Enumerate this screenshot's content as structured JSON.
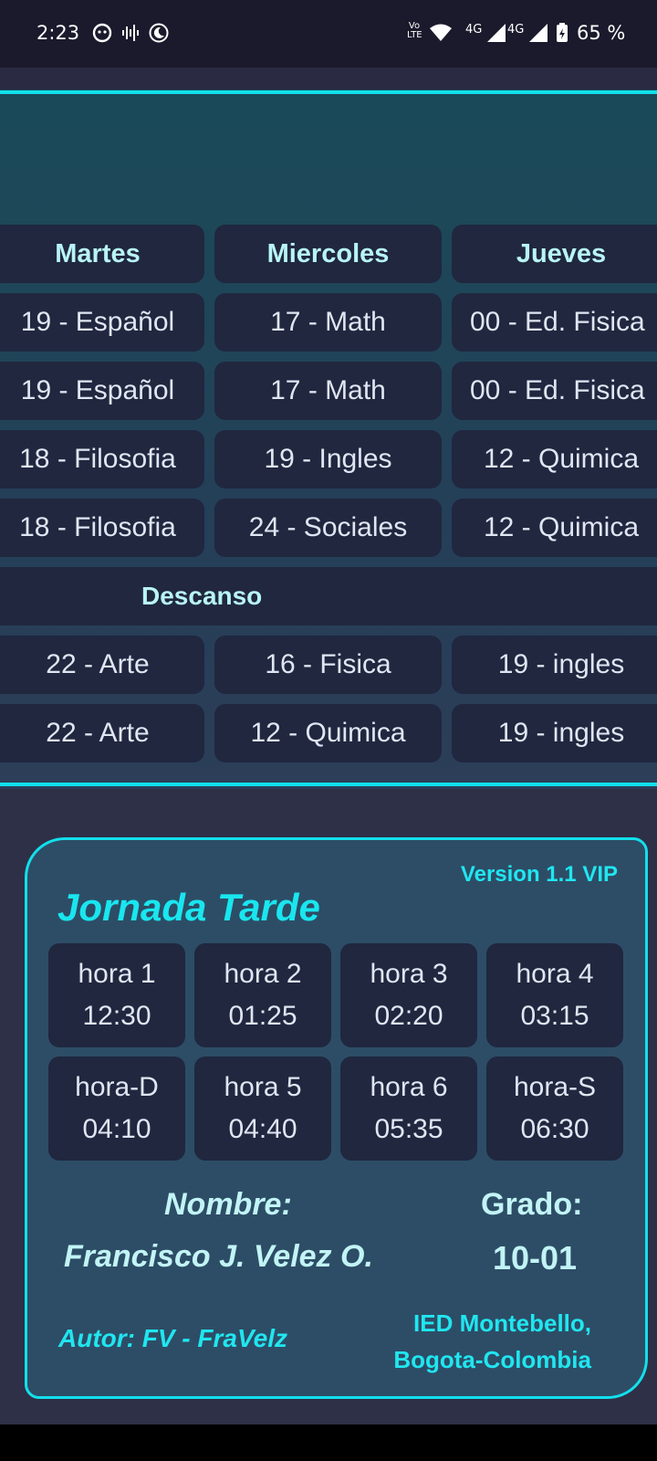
{
  "status_bar": {
    "time": "2:23",
    "signal_text": "4G",
    "signal_text_2": "4G",
    "volte": "Vo LTE",
    "battery": "65 %"
  },
  "schedule": {
    "headers": [
      "Martes",
      "Miercoles",
      "Jueves"
    ],
    "rows": [
      [
        "19 - Español",
        "17 - Math",
        "00 - Ed. Fisica"
      ],
      [
        "19 - Español",
        "17 - Math",
        "00 - Ed. Fisica"
      ],
      [
        "18 - Filosofia",
        "19 - Ingles",
        "12 - Quimica"
      ],
      [
        "18 - Filosofia",
        "24 - Sociales",
        "12 - Quimica"
      ],
      [
        "22 - Arte",
        "16 - Fisica",
        "19 - ingles"
      ],
      [
        "22 - Arte",
        "12 - Quimica",
        "19 - ingles"
      ]
    ],
    "break_label": "Descanso"
  },
  "card": {
    "version": "Version 1.1 VIP",
    "title": "Jornada Tarde",
    "hours": [
      {
        "label": "hora 1",
        "time": "12:30"
      },
      {
        "label": "hora 2",
        "time": "01:25"
      },
      {
        "label": "hora 3",
        "time": "02:20"
      },
      {
        "label": "hora 4",
        "time": "03:15"
      },
      {
        "label": "hora-D",
        "time": "04:10"
      },
      {
        "label": "hora 5",
        "time": "04:40"
      },
      {
        "label": "hora 6",
        "time": "05:35"
      },
      {
        "label": "hora-S",
        "time": "06:30"
      }
    ],
    "name_label": "Nombre:",
    "name_value": "Francisco J. Velez O.",
    "grade_label": "Grado:",
    "grade_value": "10-01",
    "author": "Autor: FV - FraVelz",
    "school_line1": "IED Montebello,",
    "school_line2": "Bogota-Colombia"
  },
  "colors": {
    "accent": "#12e0ec",
    "cell_bg": "#20273f",
    "card_bg": "#2d4d66"
  },
  "icons": [
    "face-icon",
    "sound-wave-icon",
    "night-mode-icon",
    "wifi-icon",
    "signal-icon",
    "battery-icon"
  ]
}
